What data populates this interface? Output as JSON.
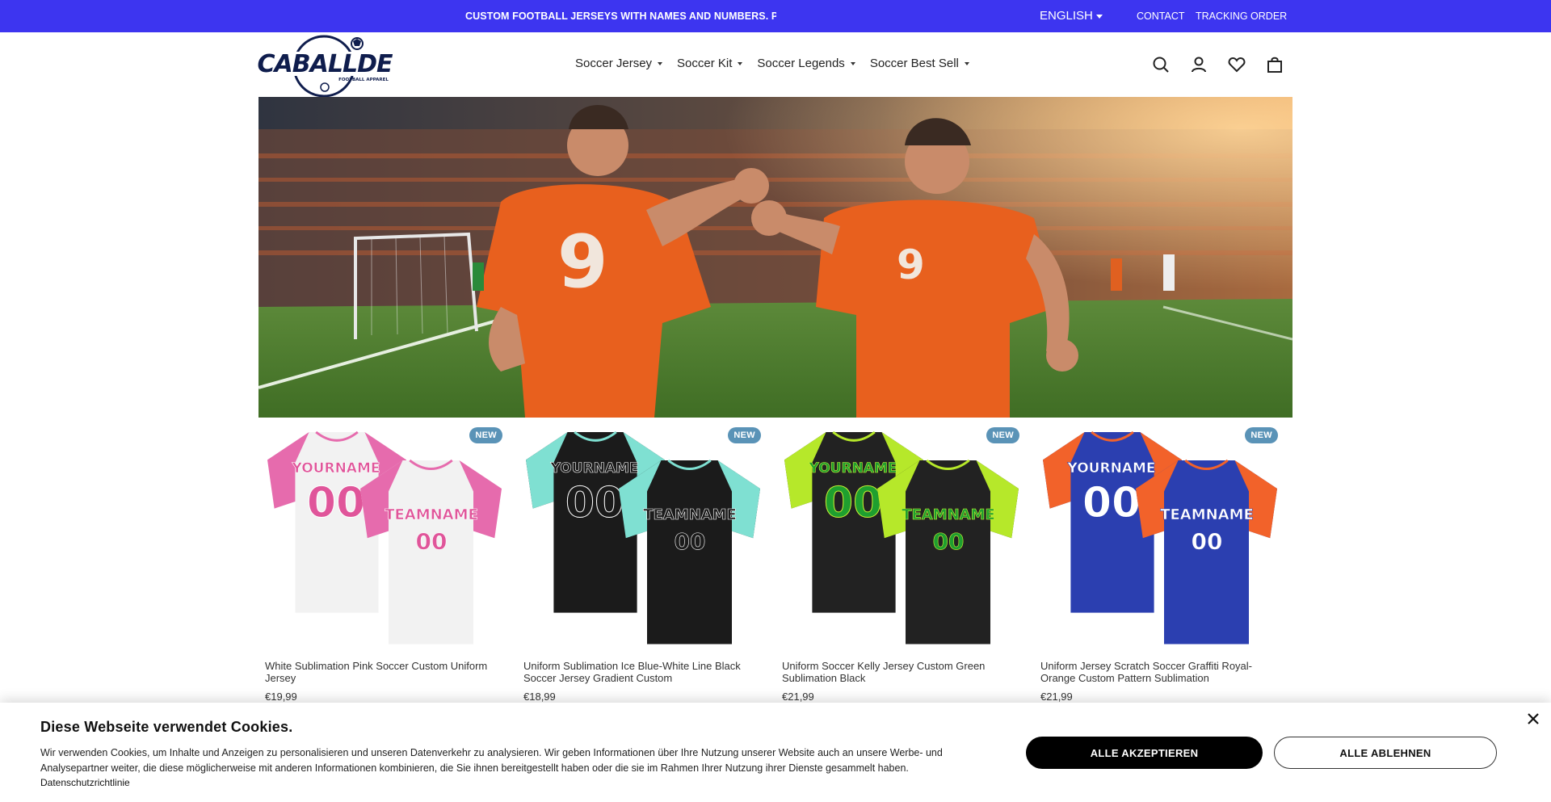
{
  "announcement": {
    "text": "CUSTOM FOOTBALL JERSEYS WITH NAMES AND NUMBERS. PREI",
    "language": "ENGLISH",
    "links": [
      "CONTACT",
      "TRACKING ORDER"
    ]
  },
  "brand": {
    "logo_text": "CABALLDE",
    "logo_subtext": "FOOTBALL APPAREL"
  },
  "nav": {
    "items": [
      "Soccer Jersey",
      "Soccer Kit",
      "Soccer Legends",
      "Soccer Best Sell"
    ]
  },
  "header_icons": [
    "search-icon",
    "account-icon",
    "wishlist-heart-icon",
    "cart-bag-icon"
  ],
  "hero": {
    "jersey_number": "9"
  },
  "products": [
    {
      "badge": "NEW",
      "title": "White Sublimation Pink Soccer Custom Uniform Jersey",
      "price": "€19,99",
      "front_text": "YOURNAME",
      "back_text": "TEAMNAME",
      "number": "00",
      "colors": {
        "body": "#f2f2f2",
        "sleeve": "#e66bad",
        "text": "#e0559a",
        "outline": "#ffffff"
      }
    },
    {
      "badge": "NEW",
      "title": "Uniform Sublimation Ice Blue-White Line Black Soccer Jersey Gradient Custom",
      "price": "€18,99",
      "front_text": "YOURNAME",
      "back_text": "TEAMNAME",
      "number": "00",
      "colors": {
        "body": "#1b1b1b",
        "sleeve": "#7fe0d2",
        "text": "#1b1b1b",
        "outline": "#ffffff"
      }
    },
    {
      "badge": "NEW",
      "title": "Uniform Soccer Kelly Jersey Custom Green Sublimation Black",
      "price": "€21,99",
      "front_text": "YOURNAME",
      "back_text": "TEAMNAME",
      "number": "00",
      "colors": {
        "body": "#222222",
        "sleeve": "#b6e82a",
        "text": "#1f9f2f",
        "outline": "#c6f132"
      }
    },
    {
      "badge": "NEW",
      "title": "Uniform Jersey Scratch Soccer Graffiti Royal-Orange Custom Pattern Sublimation",
      "price": "€21,99",
      "front_text": "YOURNAME",
      "back_text": "TEAMNAME",
      "number": "00",
      "colors": {
        "body": "#2b3fb0",
        "sleeve": "#f2622a",
        "text": "#ffffff",
        "outline": "#2b3fb0"
      }
    }
  ],
  "cookie": {
    "title": "Diese Webseite verwendet Cookies.",
    "text": "Wir verwenden Cookies, um Inhalte und Anzeigen zu personalisieren und unseren Datenverkehr zu analysieren. Wir geben Informationen über Ihre Nutzung unserer Website auch an unsere Werbe- und Analysepartner weiter, die diese möglicherweise mit anderen Informationen kombinieren, die Sie ihnen bereitgestellt haben oder die sie im Rahmen Ihrer Nutzung ihrer Dienste gesammelt haben.",
    "policy_link": "Datenschutzrichtlinie",
    "accept_label": "ALLE AKZEPTIEREN",
    "reject_label": "ALLE ABLEHNEN"
  },
  "theme": {
    "announcement_bg": "#3d35f0",
    "badge_bg": "#5a93b7",
    "logo_color": "#0f1d4d"
  }
}
